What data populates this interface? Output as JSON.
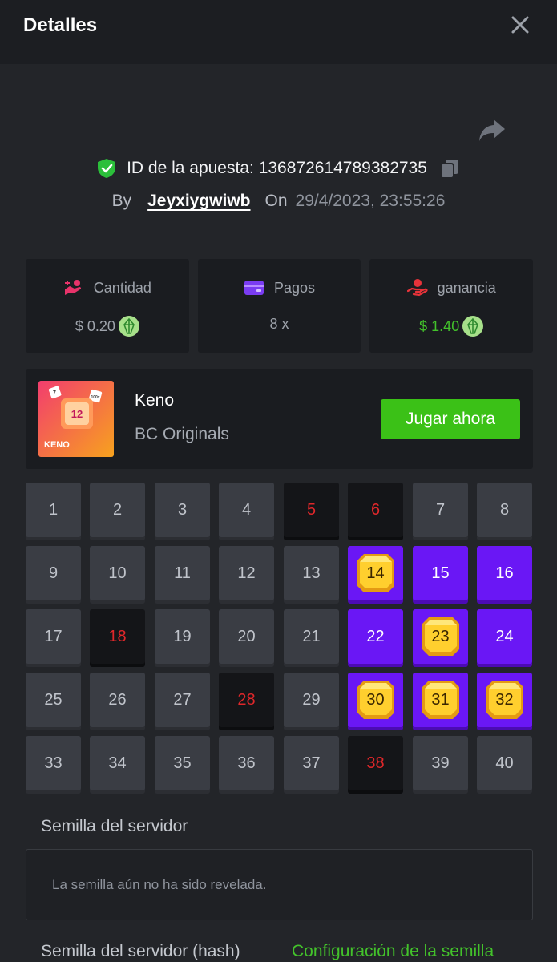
{
  "header": {
    "title": "Detalles",
    "close_icon": "close-icon"
  },
  "bet": {
    "id_label": "ID de la apuesta:",
    "id_value": "136872614789382735",
    "by_label": "By",
    "username": "Jeyxiygwiwb",
    "on_label": "On",
    "datetime": "29/4/2023, 23:55:26"
  },
  "stats": [
    {
      "label": "Cantidad",
      "value": "$ 0.20",
      "icon": "bet-amount-icon",
      "coin": "eos-coin-icon"
    },
    {
      "label": "Pagos",
      "value": "8 x",
      "icon": "payout-card-icon"
    },
    {
      "label": "ganancia",
      "value": "$ 1.40",
      "icon": "profit-hand-icon",
      "coin": "eos-coin-icon"
    }
  ],
  "game": {
    "thumb_title": "KENO",
    "thumb_number": "12",
    "thumb_die_1": "7",
    "thumb_die_2": "100x",
    "name": "Keno",
    "provider": "BC Originals",
    "play_label": "Jugar ahora"
  },
  "keno": {
    "cells": [
      {
        "n": "1",
        "s": "normal"
      },
      {
        "n": "2",
        "s": "normal"
      },
      {
        "n": "3",
        "s": "normal"
      },
      {
        "n": "4",
        "s": "normal"
      },
      {
        "n": "5",
        "s": "miss"
      },
      {
        "n": "6",
        "s": "miss"
      },
      {
        "n": "7",
        "s": "normal"
      },
      {
        "n": "8",
        "s": "normal"
      },
      {
        "n": "9",
        "s": "normal"
      },
      {
        "n": "10",
        "s": "normal"
      },
      {
        "n": "11",
        "s": "normal"
      },
      {
        "n": "12",
        "s": "normal"
      },
      {
        "n": "13",
        "s": "normal"
      },
      {
        "n": "14",
        "s": "hit"
      },
      {
        "n": "15",
        "s": "pick"
      },
      {
        "n": "16",
        "s": "pick"
      },
      {
        "n": "17",
        "s": "normal"
      },
      {
        "n": "18",
        "s": "miss"
      },
      {
        "n": "19",
        "s": "normal"
      },
      {
        "n": "20",
        "s": "normal"
      },
      {
        "n": "21",
        "s": "normal"
      },
      {
        "n": "22",
        "s": "pick"
      },
      {
        "n": "23",
        "s": "hit"
      },
      {
        "n": "24",
        "s": "pick"
      },
      {
        "n": "25",
        "s": "normal"
      },
      {
        "n": "26",
        "s": "normal"
      },
      {
        "n": "27",
        "s": "normal"
      },
      {
        "n": "28",
        "s": "miss"
      },
      {
        "n": "29",
        "s": "normal"
      },
      {
        "n": "30",
        "s": "hit"
      },
      {
        "n": "31",
        "s": "hit"
      },
      {
        "n": "32",
        "s": "hit"
      },
      {
        "n": "33",
        "s": "normal"
      },
      {
        "n": "34",
        "s": "normal"
      },
      {
        "n": "35",
        "s": "normal"
      },
      {
        "n": "36",
        "s": "normal"
      },
      {
        "n": "37",
        "s": "normal"
      },
      {
        "n": "38",
        "s": "miss"
      },
      {
        "n": "39",
        "s": "normal"
      },
      {
        "n": "40",
        "s": "normal"
      }
    ]
  },
  "seed": {
    "server_label": "Semilla del servidor",
    "server_value": "La semilla aún no ha sido revelada.",
    "hash_label": "Semilla del servidor (hash)",
    "config_link": "Configuración de la semilla"
  },
  "colors": {
    "accent_green": "#3bc117",
    "pick_purple": "#6a17f5",
    "miss_red": "#e0272a",
    "gem_gold": "#ffcf2e"
  }
}
